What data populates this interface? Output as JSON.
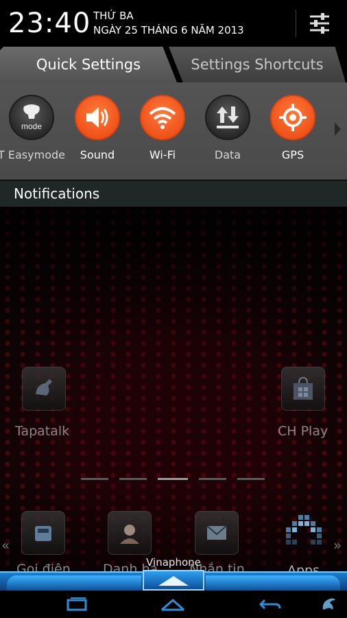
{
  "status": {
    "time": "23:40",
    "day": "THỨ BA",
    "date": "NGÀY 25 THÁNG 6 NĂM 2013",
    "settings_icon": "sliders-icon"
  },
  "tabs": [
    {
      "label": "Quick Settings",
      "active": true
    },
    {
      "label": "Settings Shortcuts",
      "active": false
    }
  ],
  "quick_settings": [
    {
      "label": "T Easymode",
      "icon": "easymode-icon",
      "badge": "mode",
      "state": "off"
    },
    {
      "label": "Sound",
      "icon": "speaker-icon",
      "state": "on"
    },
    {
      "label": "Wi-Fi",
      "icon": "wifi-icon",
      "state": "on"
    },
    {
      "label": "Data",
      "icon": "data-transfer-icon",
      "state": "off"
    },
    {
      "label": "GPS",
      "icon": "gps-icon",
      "state": "on"
    }
  ],
  "notifications": {
    "title": "Notifications"
  },
  "home": {
    "apps": [
      {
        "label": "Tapatalk",
        "icon": "tapatalk-icon"
      },
      {
        "label": "CH Play",
        "icon": "play-store-icon"
      }
    ],
    "dock": [
      {
        "label": "Gọi điện",
        "icon": "phone-icon"
      },
      {
        "label": "Danh bạ",
        "icon": "contacts-icon"
      },
      {
        "label": "Nhắn tin",
        "icon": "messages-icon"
      },
      {
        "label": "Apps",
        "icon": "apps-grid-icon"
      }
    ],
    "carrier": "Vinaphone"
  },
  "colors": {
    "accent_on": "#f0531a",
    "dock_blue": "#1b7fd1"
  }
}
